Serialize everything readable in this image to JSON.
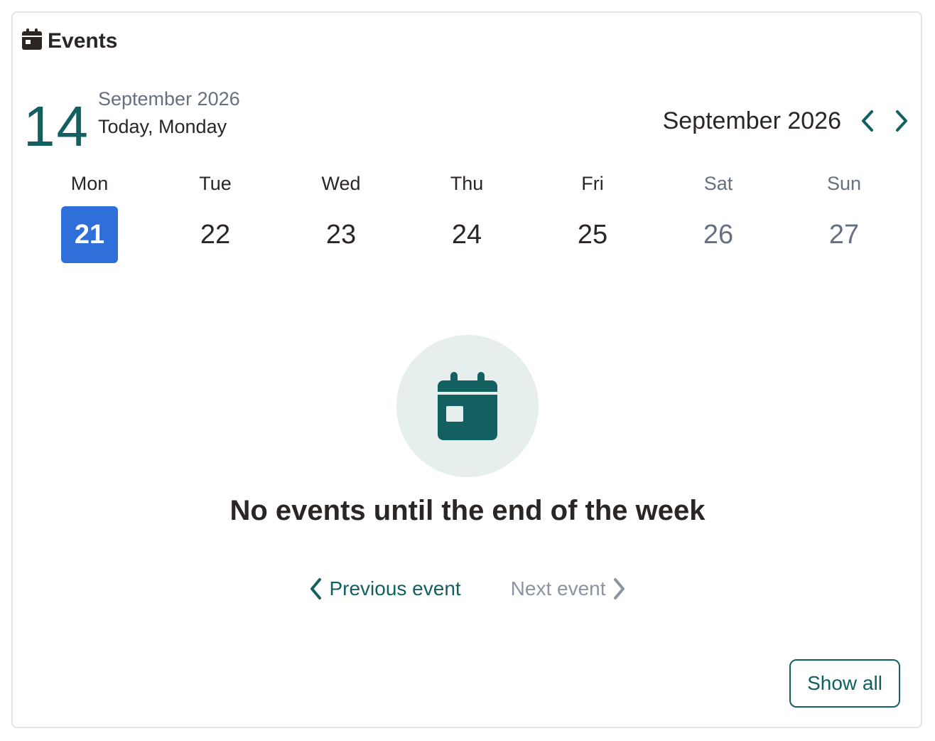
{
  "header": {
    "title": "Events",
    "icon": "calendar-icon"
  },
  "today": {
    "day_number": "14",
    "month_year": "September 2026",
    "label": "Today, Monday"
  },
  "calendar": {
    "month_label": "September 2026",
    "prev_icon": "chevron-left-icon",
    "next_icon": "chevron-right-icon",
    "days": [
      {
        "name": "Mon",
        "number": "21",
        "selected": true,
        "weekend": false
      },
      {
        "name": "Tue",
        "number": "22",
        "selected": false,
        "weekend": false
      },
      {
        "name": "Wed",
        "number": "23",
        "selected": false,
        "weekend": false
      },
      {
        "name": "Thu",
        "number": "24",
        "selected": false,
        "weekend": false
      },
      {
        "name": "Fri",
        "number": "25",
        "selected": false,
        "weekend": false
      },
      {
        "name": "Sat",
        "number": "26",
        "selected": false,
        "weekend": true
      },
      {
        "name": "Sun",
        "number": "27",
        "selected": false,
        "weekend": true
      }
    ]
  },
  "empty_state": {
    "icon": "calendar-icon",
    "message": "No events until the end of the week"
  },
  "event_nav": {
    "previous_label": "Previous event",
    "next_label": "Next event"
  },
  "footer": {
    "show_all_label": "Show all"
  },
  "colors": {
    "accent": "#12605f",
    "selected_day": "#2f6fd9",
    "muted": "#667080",
    "disabled": "#8a94a3",
    "icon_bg": "#e6efee"
  }
}
